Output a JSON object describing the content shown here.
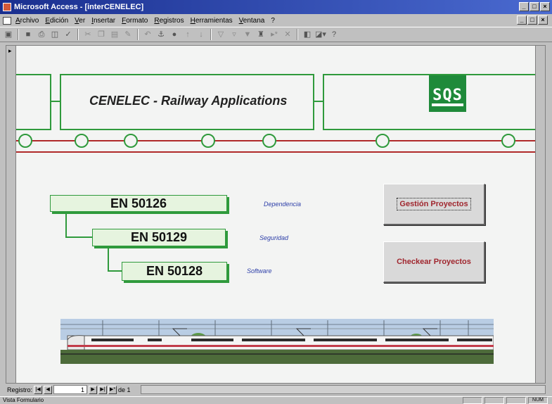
{
  "window": {
    "title": "Microsoft Access - [interCENELEC]"
  },
  "menu": {
    "items": [
      "Archivo",
      "Edición",
      "Ver",
      "Insertar",
      "Formato",
      "Registros",
      "Herramientas",
      "Ventana",
      "?"
    ]
  },
  "banner": {
    "title": "CENELEC - Railway Applications",
    "logo_text": "SQS"
  },
  "standards": [
    {
      "code": "EN 50126",
      "description": "Dependencia"
    },
    {
      "code": "EN 50129",
      "description": "Seguridad"
    },
    {
      "code": "EN 50128",
      "description": "Software"
    }
  ],
  "buttons": {
    "gestion": "Gestión Proyectos",
    "checkear": "Checkear Proyectos"
  },
  "navigation": {
    "label": "Registro:",
    "current": "1",
    "of_label": "de 1"
  },
  "status": {
    "text": "Vista Formulario",
    "mode": "NUM"
  },
  "colors": {
    "accent_green": "#2f9a3c",
    "rail_red": "#b02a2a",
    "desc_blue": "#2c3ea8",
    "button_text": "#a0262e"
  }
}
